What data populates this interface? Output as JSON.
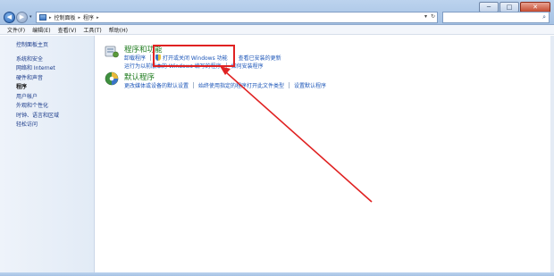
{
  "window": {
    "minimize": "─",
    "maximize": "□",
    "close": "✕"
  },
  "addressbar": {
    "crumbs": [
      "控制面板",
      "程序"
    ],
    "separator": "▸"
  },
  "search": {
    "placeholder": "",
    "icon": "search-icon"
  },
  "menu": [
    "文件(F)",
    "编辑(E)",
    "查看(V)",
    "工具(T)",
    "帮助(H)"
  ],
  "sidebar": {
    "home": "控制面板主页",
    "items": [
      "系统和安全",
      "网络和 Internet",
      "硬件和声音",
      "程序",
      "用户帐户",
      "外观和个性化",
      "时钟、语言和区域",
      "轻松访问"
    ],
    "active_index": 3
  },
  "sections": [
    {
      "title": "程序和功能",
      "row1": [
        "卸载程序",
        "打开或关闭 Windows 功能",
        "查看已安装的更新"
      ],
      "row2": [
        "运行为以前版本的 Windows 编写的程序",
        "如何安装程序"
      ]
    },
    {
      "title": "默认程序",
      "row1": [
        "更改媒体或设备的默认设置",
        "始终使用指定的程序打开此文件类型",
        "设置默认程序"
      ]
    }
  ],
  "colors": {
    "section_title": "#1e7b1e",
    "link": "#1b55b8",
    "annotation": "#e02222"
  }
}
